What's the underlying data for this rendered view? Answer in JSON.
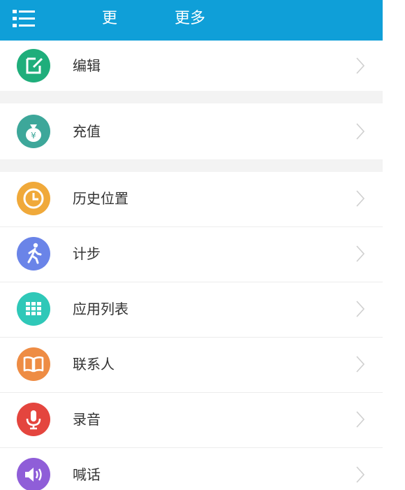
{
  "header": {
    "title_left": "更",
    "title_right": "更多",
    "background_color": "#0f9fd8"
  },
  "menu": {
    "items": [
      {
        "label": "编辑",
        "icon": "edit-icon",
        "color": "#1fae7b"
      },
      {
        "label": "充值",
        "icon": "money-bag-icon",
        "color": "#3da79a"
      },
      {
        "label": "历史位置",
        "icon": "clock-icon",
        "color": "#f0a93a"
      },
      {
        "label": "计步",
        "icon": "walking-person-icon",
        "color": "#6a84e8"
      },
      {
        "label": "应用列表",
        "icon": "apps-grid-icon",
        "color": "#2fc8b8"
      },
      {
        "label": "联系人",
        "icon": "book-icon",
        "color": "#ee8c44"
      },
      {
        "label": "录音",
        "icon": "microphone-icon",
        "color": "#e4453e"
      },
      {
        "label": "喊话",
        "icon": "speaker-icon",
        "color": "#8f5ed8"
      }
    ]
  }
}
